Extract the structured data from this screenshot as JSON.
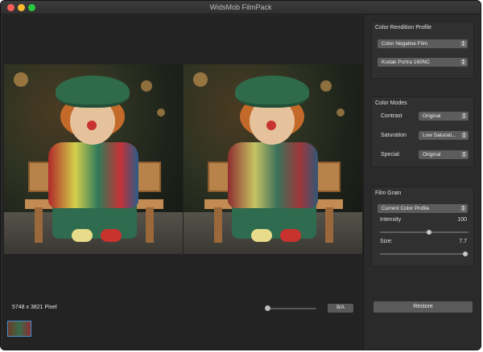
{
  "window": {
    "title": "WidsMob FilmPack"
  },
  "viewer": {
    "pixel_info": "5748 x 3821 Pixel",
    "compare_button": "B/A",
    "zoom_level": 0.05
  },
  "sidebar": {
    "color_rendition": {
      "title": "Color Rendition Profile",
      "profile_type": "Color Negative Film",
      "film": "Kodak Portra 160NC"
    },
    "color_modes": {
      "title": "Color Modes",
      "rows": [
        {
          "label": "Contrast",
          "value": "Original"
        },
        {
          "label": "Saturation",
          "value": "Low Saturati..."
        },
        {
          "label": "Special",
          "value": "Original"
        }
      ]
    },
    "film_grain": {
      "title": "Film Grain",
      "profile": "Current Color Profile",
      "intensity_label": "Intensity",
      "intensity_value": "100",
      "intensity_level": 0.55,
      "size_label": "Size:",
      "size_value": "7.7",
      "size_level": 0.96
    },
    "restore_button": "Restore"
  },
  "icons": {
    "close": "close-icon",
    "minimize": "minimize-icon",
    "maximize": "maximize-icon",
    "chevron": "chevron-updown-icon"
  }
}
